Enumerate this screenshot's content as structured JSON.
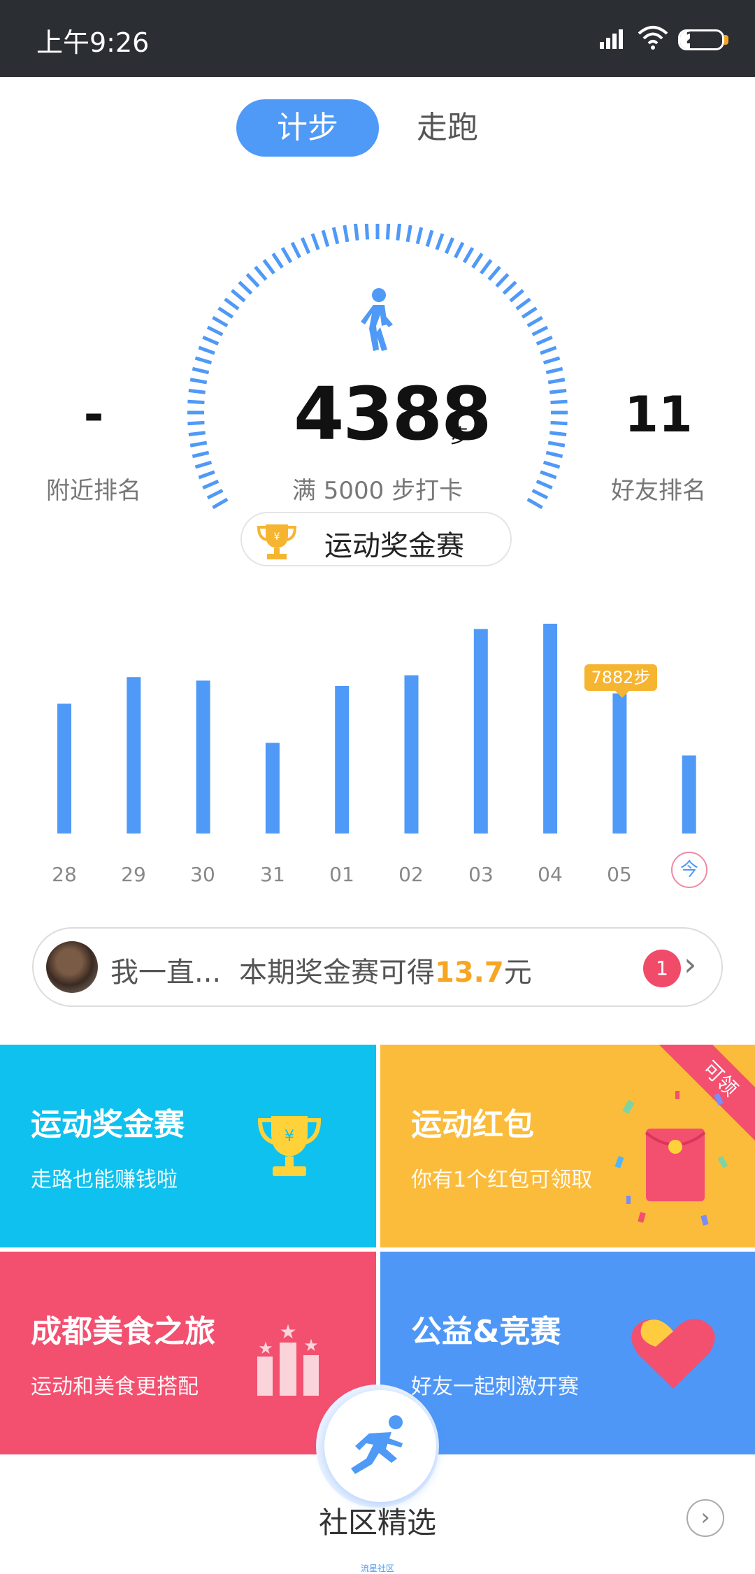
{
  "status_bar": {
    "time": "上午9:26",
    "battery": "24",
    "battery_level": 0.24
  },
  "tabs": [
    {
      "label": "计步",
      "active": true
    },
    {
      "label": "走跑",
      "active": false
    }
  ],
  "steps": {
    "count": "4388",
    "unit": "步",
    "goal_text": "满 5000 步打卡"
  },
  "nearby_rank": {
    "value": "-",
    "label": "附近排名"
  },
  "friend_rank": {
    "value": "11",
    "label": "好友排名"
  },
  "award_button": {
    "label": "运动奖金赛"
  },
  "chart_data": {
    "type": "bar",
    "categories": [
      "28",
      "29",
      "30",
      "31",
      "01",
      "02",
      "03",
      "04",
      "05",
      "今"
    ],
    "values": [
      7300,
      8800,
      8600,
      5100,
      8300,
      8900,
      11500,
      11800,
      7882,
      4388
    ],
    "highlight": {
      "category": "05",
      "label": "7882步"
    }
  },
  "notice": {
    "name": "我一直...",
    "text": "本期奖金赛可得",
    "amount": "13.7",
    "unit": "元",
    "badge": "1"
  },
  "cards": [
    {
      "title": "运动奖金赛",
      "subtitle": "走路也能赚钱啦",
      "icon": "trophy-icon"
    },
    {
      "title": "运动红包",
      "subtitle": "你有1个红包可领取",
      "icon": "red-envelope-icon",
      "ribbon": "可领"
    },
    {
      "title": "成都美食之旅",
      "subtitle": "运动和美食更搭配",
      "icon": "podium-icon"
    },
    {
      "title": "公益&竞赛",
      "subtitle": "好友一起刺激开赛",
      "icon": "heart-icon"
    }
  ],
  "community": {
    "label": "社区精选",
    "tiny_label": "流星社区"
  },
  "colors": {
    "accent": "#4f99f7",
    "gold": "#f6b531",
    "red": "#f34f6f",
    "cyan": "#0fc1ee"
  }
}
